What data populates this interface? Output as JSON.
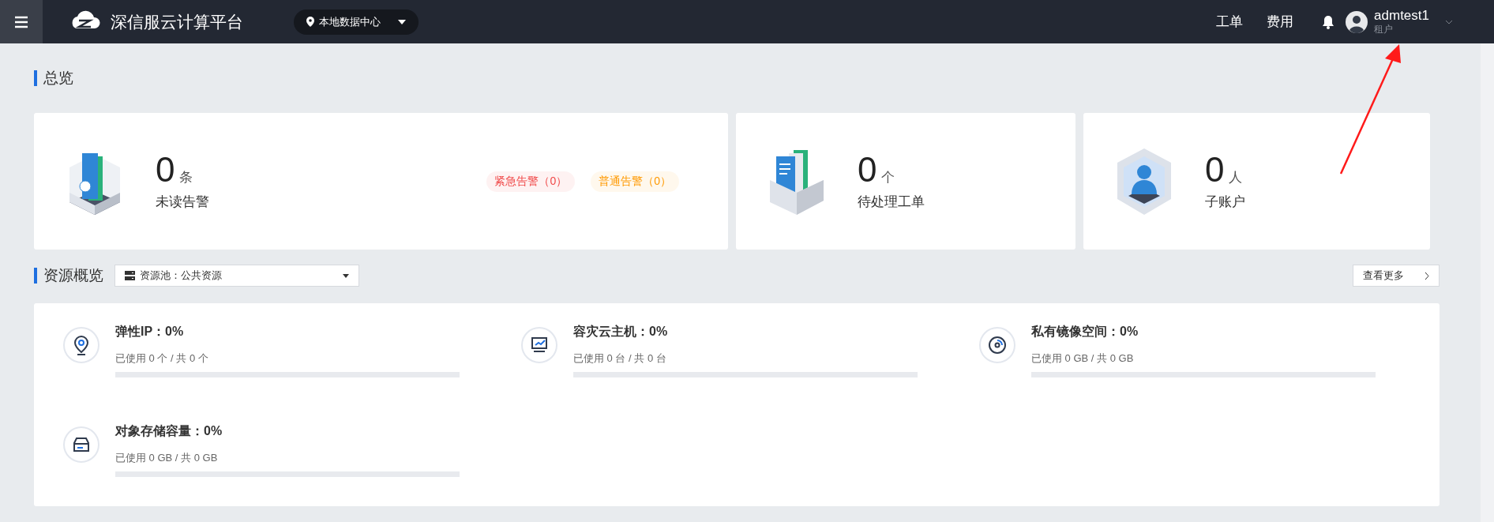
{
  "topbar": {
    "brand": "深信服云计算平台",
    "datacenter": "本地数据中心",
    "links": [
      "工单",
      "费用"
    ],
    "user": {
      "name": "admtest1",
      "role": "租户"
    }
  },
  "overview": {
    "title": "总览",
    "cards": [
      {
        "kind": "alerts",
        "value": "0",
        "unit": "条",
        "label": "未读告警",
        "badges": [
          {
            "text": "紧急告警（0）",
            "color": "#f04848"
          },
          {
            "text": "普通告警（0）",
            "color": "#ff9900"
          }
        ]
      },
      {
        "kind": "tickets",
        "value": "0",
        "unit": "个",
        "label": "待处理工单"
      },
      {
        "kind": "accounts",
        "value": "0",
        "unit": "人",
        "label": "子账户"
      }
    ]
  },
  "resources": {
    "title": "资源概览",
    "pool": "资源池：公共资源",
    "more": "查看更多",
    "items": [
      {
        "kind": "ip",
        "title": "弹性IP：0%",
        "usage": "已使用 0 个 / 共 0 个",
        "level": 0
      },
      {
        "kind": "host",
        "title": "容灾云主机：0%",
        "usage": "已使用 0 台 / 共 0 台",
        "level": 0
      },
      {
        "kind": "image",
        "title": "私有镜像空间：0%",
        "usage": "已使用 0 GB / 共 0 GB",
        "level": 0
      },
      {
        "kind": "storage",
        "title": "对象存储容量：0%",
        "usage": "已使用 0 GB / 共 0 GB",
        "level": 0
      }
    ]
  }
}
